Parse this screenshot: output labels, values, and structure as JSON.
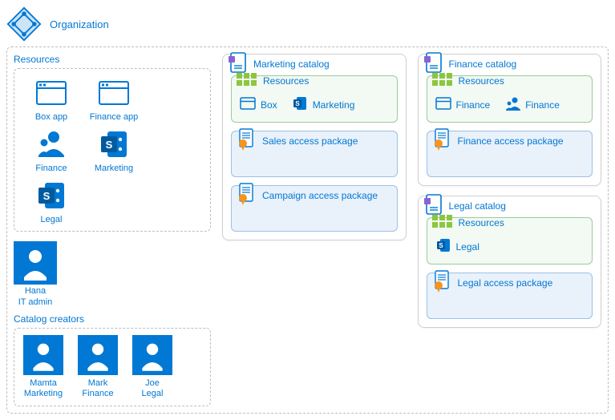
{
  "organization": {
    "label": "Organization"
  },
  "left": {
    "resources_label": "Resources",
    "resources": [
      {
        "label": "Box app",
        "icon": "app"
      },
      {
        "label": "Finance app",
        "icon": "app"
      },
      {
        "label": "Finance",
        "icon": "group"
      },
      {
        "label": "Marketing",
        "icon": "sharepoint"
      },
      {
        "label": "Legal",
        "icon": "sharepoint"
      }
    ],
    "admin": {
      "name": "Hana",
      "role": "IT admin"
    },
    "creators_label": "Catalog creators",
    "creators": [
      {
        "name": "Mamta",
        "dept": "Marketing"
      },
      {
        "name": "Mark",
        "dept": "Finance"
      },
      {
        "name": "Joe",
        "dept": "Legal"
      }
    ]
  },
  "catalogs": {
    "marketing": {
      "title": "Marketing catalog",
      "resources_label": "Resources",
      "resources": [
        {
          "label": "Box",
          "icon": "app-sm"
        },
        {
          "label": "Marketing",
          "icon": "sharepoint-sm"
        }
      ],
      "packages": [
        {
          "label": "Sales access package"
        },
        {
          "label": "Campaign access package"
        }
      ]
    },
    "finance": {
      "title": "Finance catalog",
      "resources_label": "Resources",
      "resources": [
        {
          "label": "Finance",
          "icon": "app-sm"
        },
        {
          "label": "Finance",
          "icon": "group-sm"
        }
      ],
      "packages": [
        {
          "label": "Finance access package"
        }
      ]
    },
    "legal": {
      "title": "Legal catalog",
      "resources_label": "Resources",
      "resources": [
        {
          "label": "Legal",
          "icon": "sharepoint-sm"
        }
      ],
      "packages": [
        {
          "label": "Legal access package"
        }
      ]
    }
  }
}
